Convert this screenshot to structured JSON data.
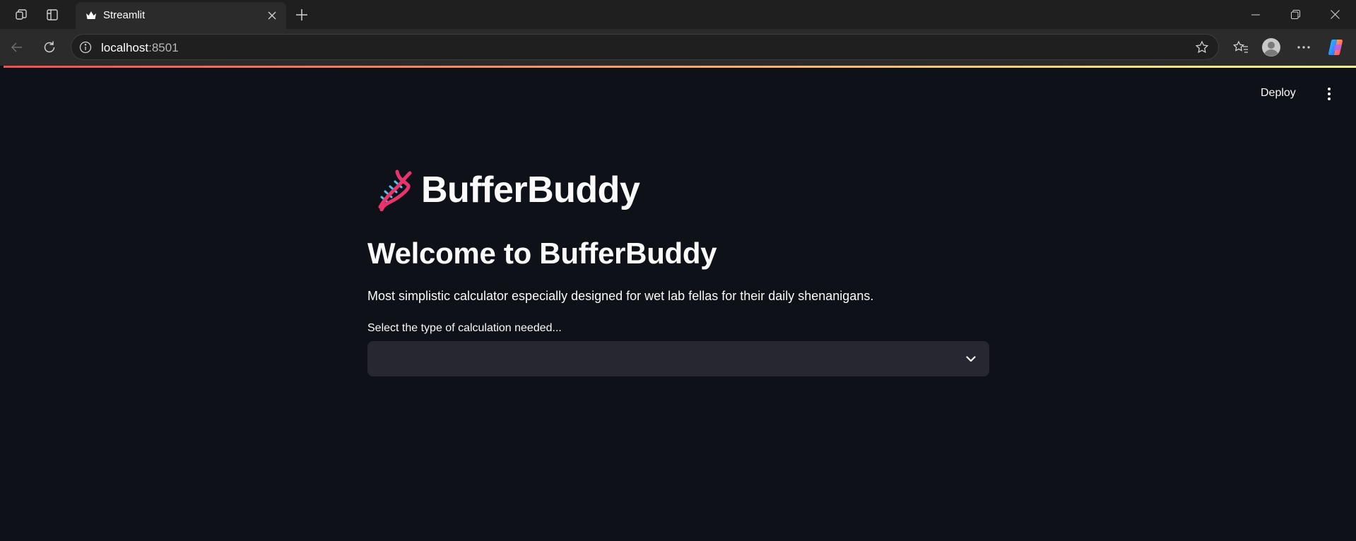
{
  "browser": {
    "tab_title": "Streamlit",
    "url_host": "localhost",
    "url_port": ":8501",
    "icons": [
      "workspaces-icon",
      "vertical-tabs-icon",
      "streamlit-crown-icon",
      "close-tab-icon",
      "new-tab-icon",
      "minimize-icon",
      "restore-icon",
      "window-close-icon",
      "back-icon",
      "refresh-icon",
      "info-icon",
      "star-icon",
      "favorites-icon",
      "profile-icon",
      "more-icon",
      "copilot-icon"
    ]
  },
  "app": {
    "deploy_label": "Deploy",
    "title": "BufferBuddy",
    "welcome_heading": "Welcome to BufferBuddy",
    "description": "Most simplistic calculator especially designed for wet lab fellas for their daily shenanigans.",
    "select_label": "Select the type of calculation needed...",
    "select_value": "",
    "colors": {
      "background": "#0e1117",
      "select_bg": "#262730",
      "text": "#fafafa",
      "decoration_start": "#ff4b4b",
      "decoration_end": "#fffd80"
    }
  }
}
